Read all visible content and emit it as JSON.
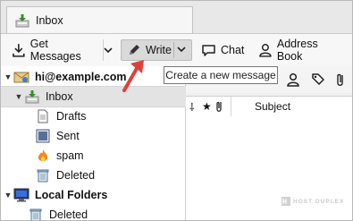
{
  "tab": {
    "label": "Inbox"
  },
  "toolbar": {
    "get_messages": "Get Messages",
    "write": "Write",
    "chat": "Chat",
    "address_book": "Address Book"
  },
  "tooltip": "Create a new message",
  "folders": {
    "account": "hi@example.com",
    "inbox": "Inbox",
    "drafts": "Drafts",
    "sent": "Sent",
    "spam": "spam",
    "deleted": "Deleted",
    "local_folders": "Local Folders",
    "local_deleted": "Deleted"
  },
  "message_list": {
    "columns": {
      "subject": "Subject"
    }
  },
  "watermark": "HOST DUPLEX",
  "colors": {
    "arrow": "#e0403a",
    "selected_row": "#e3e3e3",
    "accent": "#3a8c2e"
  }
}
